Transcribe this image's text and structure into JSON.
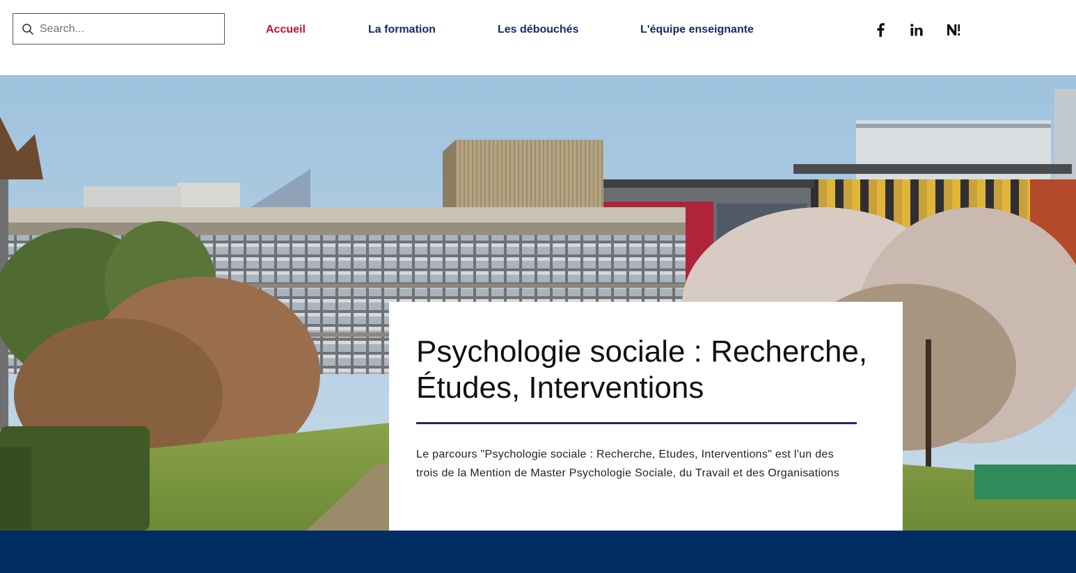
{
  "search": {
    "placeholder": "Search..."
  },
  "nav": {
    "items": [
      {
        "label": "Accueil",
        "active": true
      },
      {
        "label": "La formation",
        "active": false
      },
      {
        "label": "Les débouchés",
        "active": false
      },
      {
        "label": "L'équipe enseignante",
        "active": false
      }
    ]
  },
  "social": {
    "icons": [
      "facebook-icon",
      "linkedin-icon",
      "n-brand-icon"
    ]
  },
  "hero": {
    "title": "Psychologie sociale : Recherche, Études, Interventions",
    "description": "Le parcours \"Psychologie sociale : Recherche, Etudes, Interventions\" est l'un des trois de la Mention de Master Psychologie Sociale, du Travail et des Organisations"
  },
  "colors": {
    "nav_text": "#172a63",
    "nav_active": "#c8102e",
    "title_rule": "#1e2a5a",
    "footer_band": "#002d62"
  }
}
